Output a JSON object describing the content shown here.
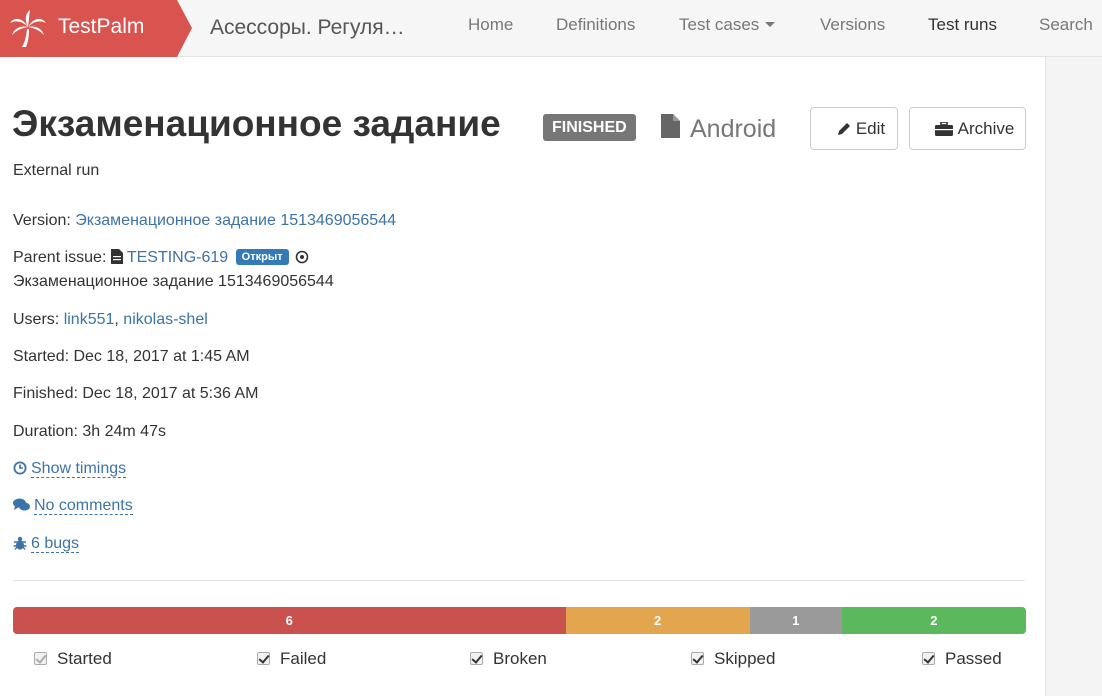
{
  "navbar": {
    "brand": "TestPalm",
    "project": "Асессоры. Регуля…",
    "links": [
      "Home",
      "Definitions",
      "Test cases",
      "Versions",
      "Test runs",
      "Search"
    ],
    "brand_color": "#d9534f"
  },
  "header": {
    "title": "Экзаменационное задание",
    "status": "FINISHED",
    "platform": "Android",
    "edit_label": "Edit",
    "archive_label": "Archive"
  },
  "run": {
    "type": "External run",
    "version_label": "Version:",
    "version_value": "Экзаменационное задание 1513469056544",
    "parent_label": "Parent issue:",
    "parent_key": "TESTING-619",
    "parent_status": "Открыт",
    "parent_summary": "Экзаменационное задание 1513469056544",
    "users_label": "Users:",
    "user_1": "link551",
    "user_sep": ",",
    "user_2": "nikolas-shel",
    "started": "Started: Dec 18, 2017 at 1:45 AM",
    "finished": "Finished: Dec 18, 2017 at 5:36 AM",
    "duration": "Duration: 3h 24m 47s",
    "show_timings": "Show timings",
    "comments": "No comments",
    "bugs": "6 bugs"
  },
  "progress": {
    "segments": [
      {
        "label": "6",
        "value": 6,
        "color": "#c9524f"
      },
      {
        "label": "2",
        "value": 2,
        "color": "#e3a54e"
      },
      {
        "label": "1",
        "value": 1,
        "color": "#9a9a9a"
      },
      {
        "label": "2",
        "value": 2,
        "color": "#5cb85c"
      }
    ]
  },
  "legend": [
    "Started",
    "Failed",
    "Broken",
    "Skipped",
    "Passed"
  ]
}
